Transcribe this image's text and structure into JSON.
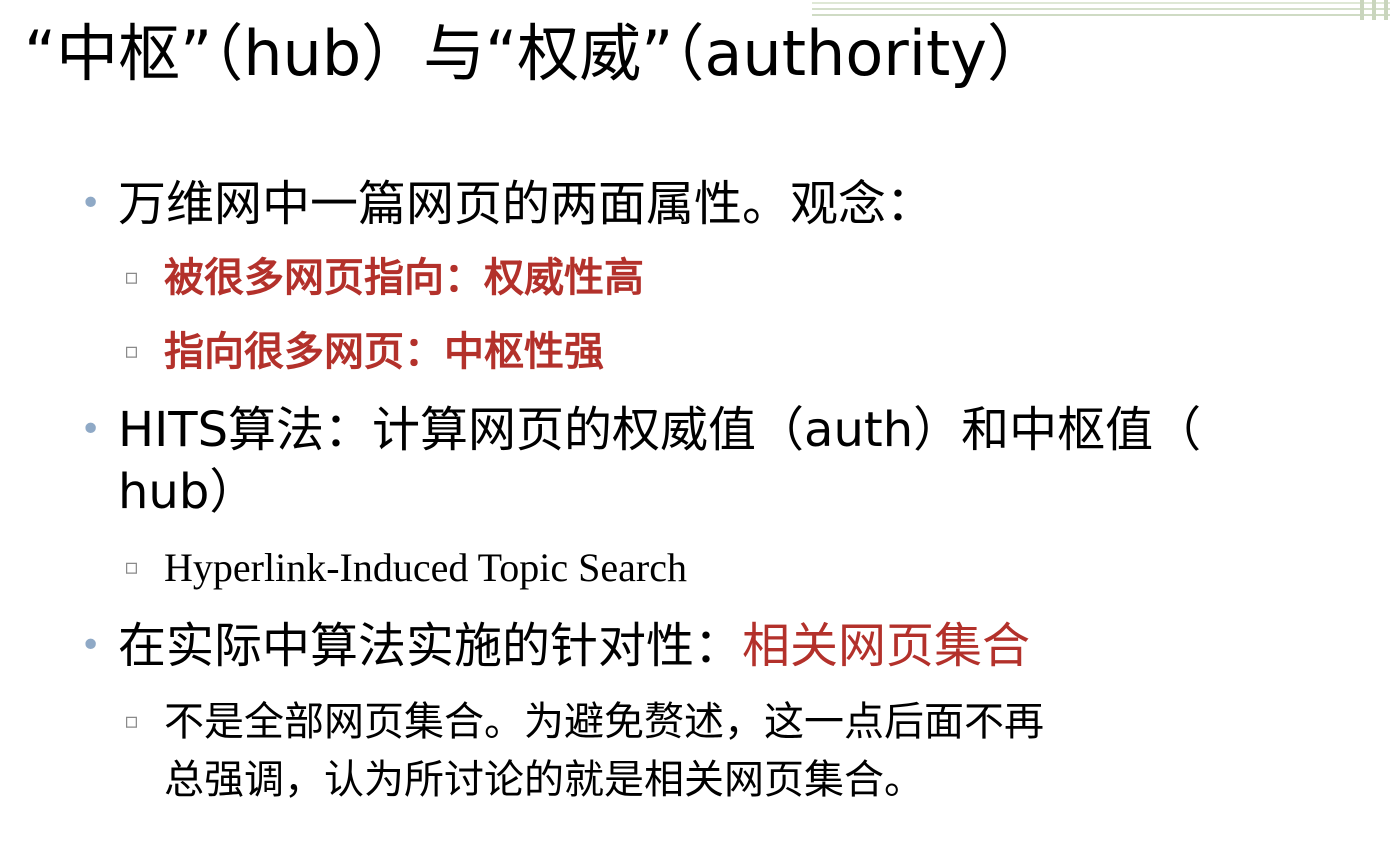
{
  "title": "“中枢”（hub）与“权威”（authority）",
  "bullets": {
    "b1": "万维网中一篇网页的两面属性。观念：",
    "b1_sub1": "被很多网页指向：权威性高",
    "b1_sub2": "指向很多网页：中枢性强",
    "b2_line1": "HITS算法：计算网页的权威值（auth）和中枢值（",
    "b2_line2": "hub）",
    "b2_sub1": "Hyperlink-Induced Topic Search",
    "b3_prefix": "在实际中算法实施的针对性：",
    "b3_highlight": "相关网页集合",
    "b3_sub1_line1": "不是全部网页集合。为避免赘述，这一点后面不再",
    "b3_sub1_line2": "总强调，认为所讨论的就是相关网页集合。"
  },
  "colors": {
    "accent_red": "#b3312b",
    "bullet_blue": "#8fa9c6"
  }
}
